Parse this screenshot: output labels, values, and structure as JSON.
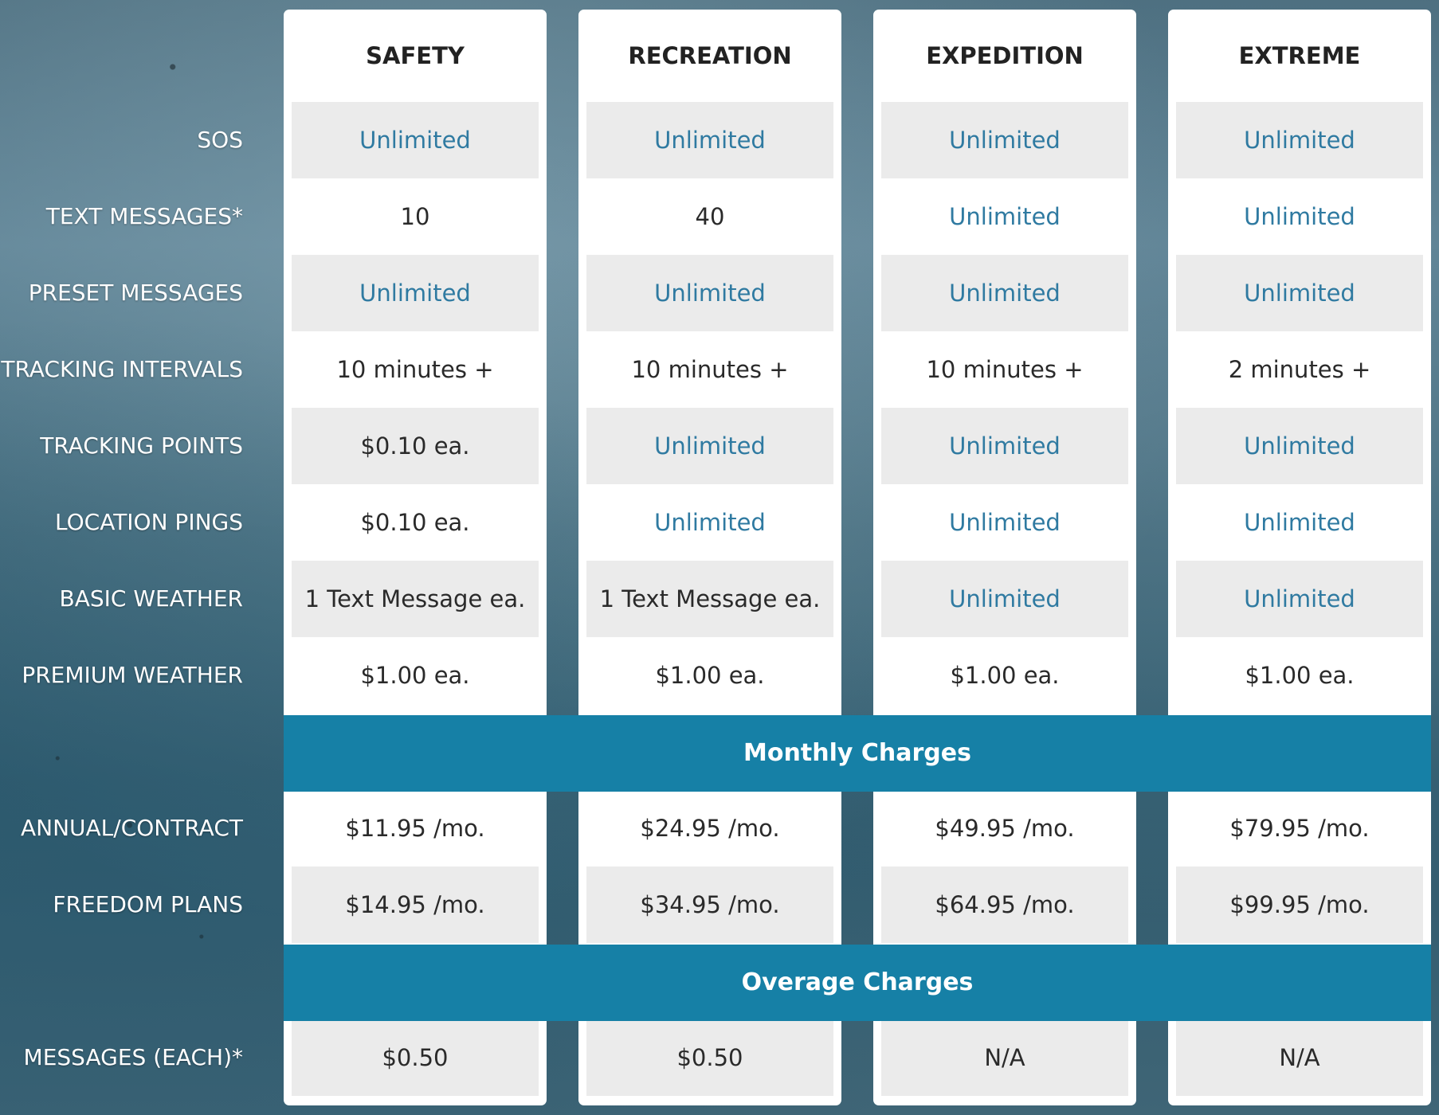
{
  "row_labels": [
    "SOS",
    "TEXT MESSAGES*",
    "PRESET MESSAGES",
    "TRACKING INTERVALS",
    "TRACKING POINTS",
    "LOCATION PINGS",
    "BASIC WEATHER",
    "PREMIUM WEATHER",
    "ANNUAL/CONTRACT",
    "FREEDOM PLANS",
    "MESSAGES (EACH)*"
  ],
  "sections": {
    "monthly": "Monthly Charges",
    "overage": "Overage Charges"
  },
  "colors": {
    "band": "#1680a6",
    "accent_text": "#2f7aa1",
    "shaded_cell": "#ebebeb"
  },
  "plans": [
    {
      "name": "SAFETY",
      "values": [
        "Unlimited",
        "10",
        "Unlimited",
        "10 minutes +",
        "$0.10 ea.",
        "$0.10 ea.",
        "1 Text Message ea.",
        "$1.00 ea.",
        "$11.95 /mo.",
        "$14.95 /mo.",
        "$0.50"
      ]
    },
    {
      "name": "RECREATION",
      "values": [
        "Unlimited",
        "40",
        "Unlimited",
        "10 minutes +",
        "Unlimited",
        "Unlimited",
        "1 Text Message ea.",
        "$1.00 ea.",
        "$24.95 /mo.",
        "$34.95 /mo.",
        "$0.50"
      ]
    },
    {
      "name": "EXPEDITION",
      "values": [
        "Unlimited",
        "Unlimited",
        "Unlimited",
        "10 minutes +",
        "Unlimited",
        "Unlimited",
        "Unlimited",
        "$1.00 ea.",
        "$49.95 /mo.",
        "$64.95 /mo.",
        "N/A"
      ]
    },
    {
      "name": "EXTREME",
      "values": [
        "Unlimited",
        "Unlimited",
        "Unlimited",
        "2 minutes +",
        "Unlimited",
        "Unlimited",
        "Unlimited",
        "$1.00 ea.",
        "$79.95 /mo.",
        "$99.95 /mo.",
        "N/A"
      ]
    }
  ]
}
